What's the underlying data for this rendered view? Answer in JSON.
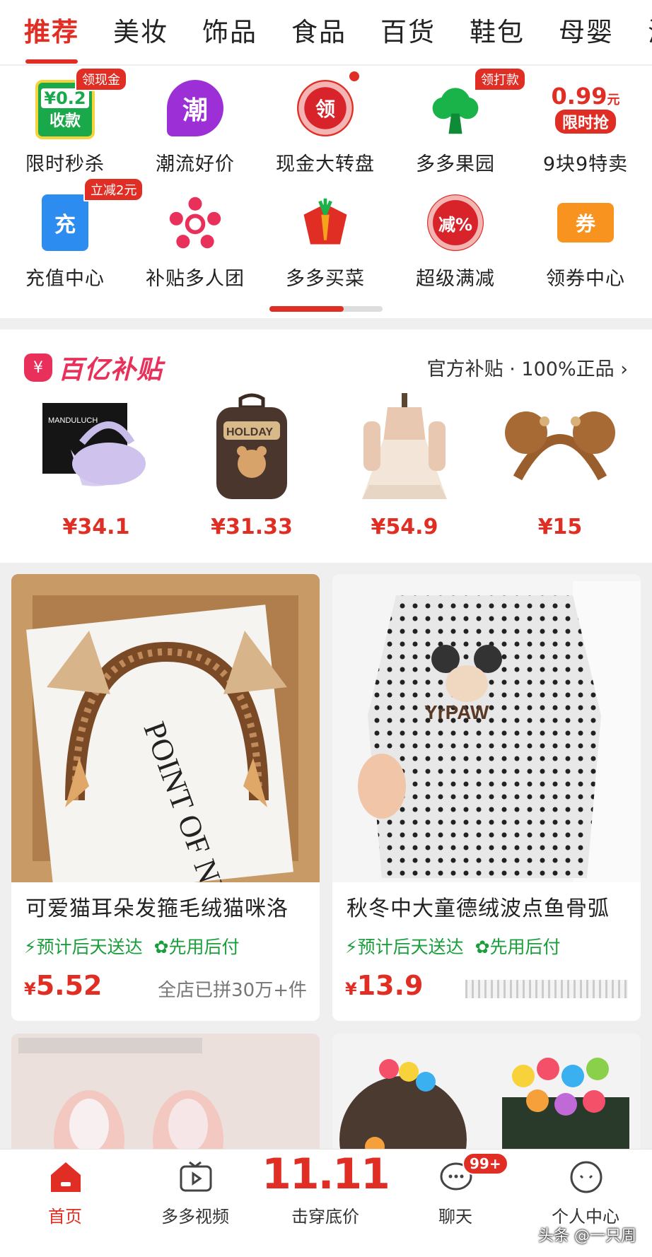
{
  "category_tabs": [
    "推荐",
    "美妆",
    "饰品",
    "食品",
    "百货",
    "鞋包",
    "母婴",
    "海"
  ],
  "features": [
    {
      "label": "限时秒杀",
      "icon": "cash-collect-icon",
      "icon_text": "¥0.2",
      "icon_sub": "收款",
      "tag": "领现金"
    },
    {
      "label": "潮流好价",
      "icon": "trend-icon",
      "icon_text": "潮"
    },
    {
      "label": "现金大转盘",
      "icon": "wheel-icon",
      "icon_text": "领"
    },
    {
      "label": "多多果园",
      "icon": "tree-icon",
      "tag": "领打款"
    },
    {
      "label": "9块9特卖",
      "icon": "sale-icon",
      "icon_text": "0.99",
      "icon_unit": "元",
      "icon_sub": "限时抢"
    },
    {
      "label": "充值中心",
      "icon": "recharge-icon",
      "icon_text": "充",
      "tag": "立减2元"
    },
    {
      "label": "补贴多人团",
      "icon": "group-icon"
    },
    {
      "label": "多多买菜",
      "icon": "carrot-icon"
    },
    {
      "label": "超级满减",
      "icon": "discount-icon",
      "icon_text": "减%"
    },
    {
      "label": "领券中心",
      "icon": "coupon-icon",
      "icon_text": "券"
    }
  ],
  "subsidy": {
    "logo_icon_text": "¥",
    "title": "百亿补贴",
    "desc": "官方补贴 · 100%正品",
    "items": [
      {
        "name": "handbag",
        "price": "¥34.1",
        "box_text": "MANDULUCH"
      },
      {
        "name": "backpack",
        "price": "¥31.33",
        "print_text": "HOLDAY"
      },
      {
        "name": "dress",
        "price": "¥54.9"
      },
      {
        "name": "headband",
        "price": "¥15"
      }
    ]
  },
  "products": [
    {
      "title": "可爱猫耳朵发箍毛绒猫咪洛",
      "badge1": "预计后天送达",
      "badge2": "先用后付",
      "currency": "¥",
      "price": "5.52",
      "sold": "全店已拼30万+件",
      "print_text": "POINT OF NEW"
    },
    {
      "title": "秋冬中大童德绒波点鱼骨弧",
      "badge1": "预计后天送达",
      "badge2": "先用后付",
      "currency": "¥",
      "price": "13.9",
      "sold": "",
      "print_text": "YrPAW"
    }
  ],
  "bottom_nav": [
    {
      "label": "首页",
      "icon": "home-icon",
      "active": true
    },
    {
      "label": "多多视频",
      "icon": "video-icon"
    },
    {
      "label": "击穿底价",
      "icon": "double-eleven-icon",
      "big_text": "11.11"
    },
    {
      "label": "聊天",
      "icon": "chat-icon",
      "badge": "99+"
    },
    {
      "label": "个人中心",
      "icon": "profile-icon"
    }
  ],
  "watermark": "头条 @一只周",
  "colors": {
    "accent": "#e02e24",
    "green": "#1a9e3b",
    "subsidy_pink": "#e8305a"
  }
}
